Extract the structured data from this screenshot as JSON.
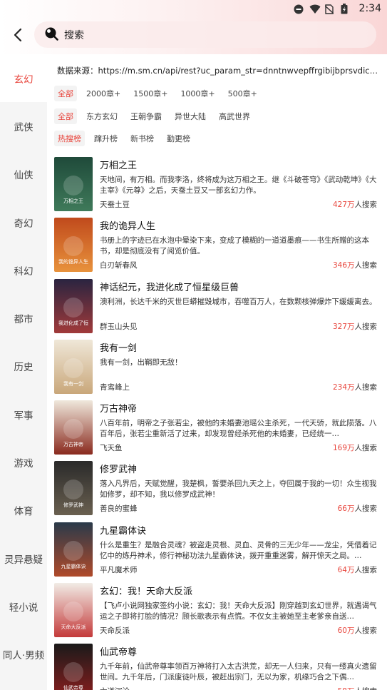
{
  "status": {
    "time": "2:34"
  },
  "header": {
    "search_text": "搜索"
  },
  "sidebar": {
    "items": [
      {
        "label": "玄幻",
        "active": true
      },
      {
        "label": "武侠",
        "active": false
      },
      {
        "label": "仙侠",
        "active": false
      },
      {
        "label": "奇幻",
        "active": false
      },
      {
        "label": "科幻",
        "active": false
      },
      {
        "label": "都市",
        "active": false
      },
      {
        "label": "历史",
        "active": false
      },
      {
        "label": "军事",
        "active": false
      },
      {
        "label": "游戏",
        "active": false
      },
      {
        "label": "体育",
        "active": false
      },
      {
        "label": "灵异悬疑",
        "active": false
      },
      {
        "label": "轻小说",
        "active": false
      },
      {
        "label": "同人·男频",
        "active": false
      }
    ]
  },
  "source_text": "数据来源：https://m.sm.cn/api/rest?uc_param_str=dnntnwvepffrgibijbprsvdichei&format=json",
  "filters": {
    "length": [
      {
        "label": "全部",
        "active": true
      },
      {
        "label": "2000章+",
        "active": false
      },
      {
        "label": "1500章+",
        "active": false
      },
      {
        "label": "1000章+",
        "active": false
      },
      {
        "label": "500章+",
        "active": false
      }
    ],
    "category": [
      {
        "label": "全部",
        "active": true
      },
      {
        "label": "东方玄幻",
        "active": false
      },
      {
        "label": "王朝争霸",
        "active": false
      },
      {
        "label": "异世大陆",
        "active": false
      },
      {
        "label": "高武世界",
        "active": false
      }
    ],
    "ranking": [
      {
        "label": "热搜榜",
        "active": true
      },
      {
        "label": "蹿升榜",
        "active": false
      },
      {
        "label": "新书榜",
        "active": false
      },
      {
        "label": "勤更榜",
        "active": false
      }
    ]
  },
  "search_suffix": "人搜索",
  "books": [
    {
      "title": "万相之王",
      "desc": "天地间，有万相。而我李洛，终将成为这万相之王。继《斗破苍穹》《武动乾坤》《大主宰》《元尊》之后，天蚕土豆又一部玄幻力作。",
      "author": "天蚕土豆",
      "count": "427万",
      "cover_colors": [
        "#1f4a3a",
        "#3f7a5a"
      ],
      "cover_text": "万相之王"
    },
    {
      "title": "我的诡异人生",
      "desc": "书册上的字迹已在水泡中晕染下来，变成了模糊的一道道墨痕——书生所赠的这本书，却是彻底没有了阅览价值。",
      "author": "白刃斩春风",
      "count": "346万",
      "cover_colors": [
        "#c04a1c",
        "#e8923c"
      ],
      "cover_text": "我的诡异人生"
    },
    {
      "title": "神话纪元，我进化成了恒星级巨兽",
      "desc": "澳利洲，长达千米的灭世巨蟒摧毁城市，吞噬百万人，在数颗核弹爆炸下缓缓离去。",
      "author": "群玉山头见",
      "count": "327万",
      "cover_colors": [
        "#2a2440",
        "#a13a3a"
      ],
      "cover_text": "我进化成了恒星级巨兽"
    },
    {
      "title": "我有一剑",
      "desc": "我有一剑，出鞘即无敌！",
      "author": "青鸾峰上",
      "count": "234万",
      "cover_colors": [
        "#efe7d8",
        "#c9a77a"
      ],
      "cover_text": "我有一剑"
    },
    {
      "title": "万古神帝",
      "desc": "八百年前，明帝之子张若尘，被他的未婚妻池瑶公主杀死，一代天骄，就此陨落。八百年后，张若尘重新活了过来，却发现曾经杀死他的未婚妻，已经统一…",
      "author": "飞天鱼",
      "count": "169万",
      "cover_colors": [
        "#efe8dc",
        "#8a2a1e"
      ],
      "cover_text": "万古神帝"
    },
    {
      "title": "修罗武神",
      "desc": "落入凡界后，天赋觉醒，我楚枫，誓要杀回九天之上，夺回属于我的一切！众生视我如修罗，却不知，我以修罗成武神！",
      "author": "善良的蜜蜂",
      "count": "66万",
      "cover_colors": [
        "#2a2a2a",
        "#6a6050"
      ],
      "cover_text": "修罗武神"
    },
    {
      "title": "九星霸体诀",
      "desc": "什么是重生？是融合灵魂？被盗走灵根、灵血、灵骨的三无少年——龙尘，凭借着记忆中的炼丹神术，修行神秘功法九星霸体诀，拨开重重迷雾，解开惊天之局。…",
      "author": "平凡魔术师",
      "count": "64万",
      "cover_colors": [
        "#2a3a4a",
        "#b04a2a"
      ],
      "cover_text": "九星霸体诀"
    },
    {
      "title": "玄幻：我！天命大反派",
      "desc": "【飞卢小说网独家签约小说：玄幻：我！天命大反派】刚穿越到玄幻世界，就遇谒气运之子即将打脸的情况？顾长歌表示有点慌。不仅女主被她至主老爹亲自送…",
      "author": "天命反派",
      "count": "60万",
      "cover_colors": [
        "#f1ece6",
        "#c43a3a"
      ],
      "cover_text": "天命大反派"
    },
    {
      "title": "仙武帝尊",
      "desc": "九千年前，仙武帝尊率领百万神将打入太古洪荒，却无一人归来，只有一缕真火遗留世间。九千年后，门派废徒叶辰，被赶出宗门，无以为家，机缘巧合之下偶…",
      "author": "六道沉沦",
      "count": "58万",
      "cover_colors": [
        "#1a1a1a",
        "#8a1e1e"
      ],
      "cover_text": "仙武帝尊"
    }
  ]
}
